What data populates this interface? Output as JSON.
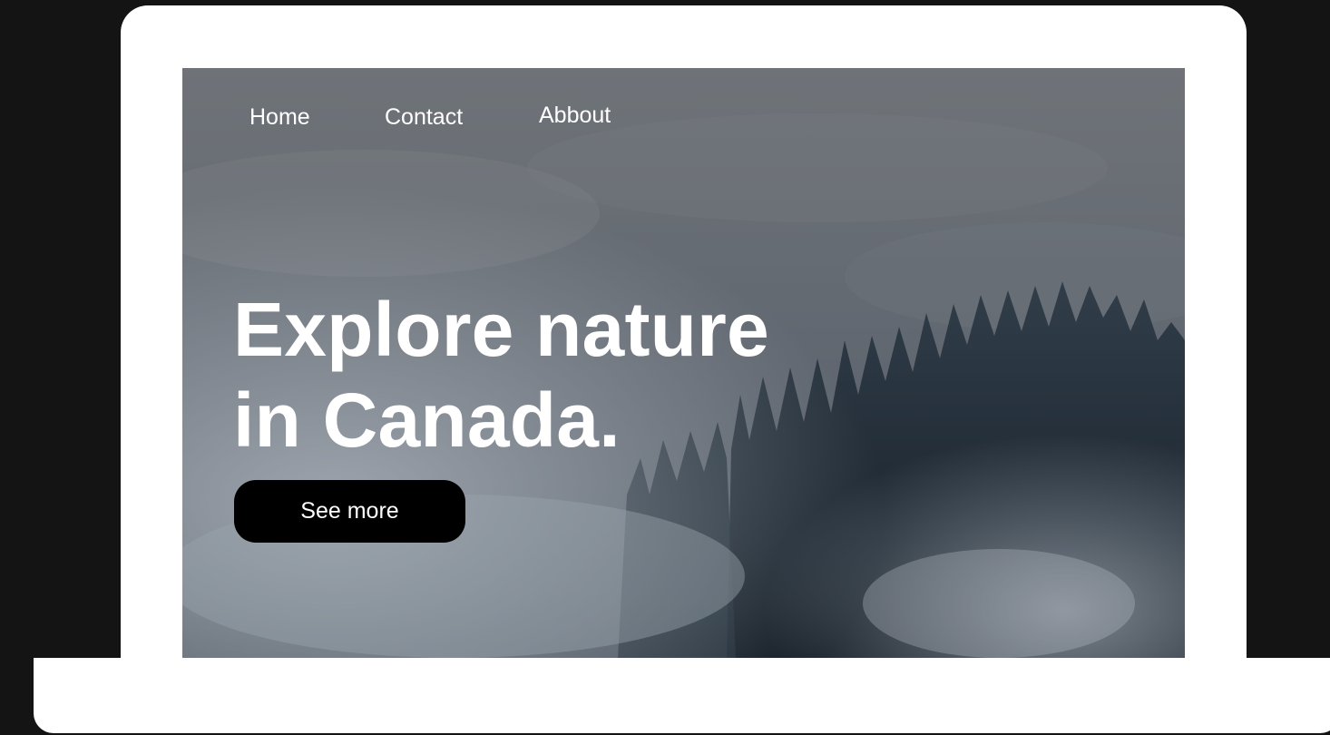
{
  "nav": {
    "items": [
      {
        "label": "Home"
      },
      {
        "label": "Contact"
      },
      {
        "label": "Abbout"
      }
    ]
  },
  "hero": {
    "title_line_1": "Explore nature",
    "title_line_2": "in Canada.",
    "cta_label": "See more"
  },
  "colors": {
    "backdrop": "#141414",
    "device_frame": "#ffffff",
    "text": "#ffffff",
    "button_bg": "#000000"
  },
  "icons": {
    "hero_image": "misty-forest-photo"
  }
}
